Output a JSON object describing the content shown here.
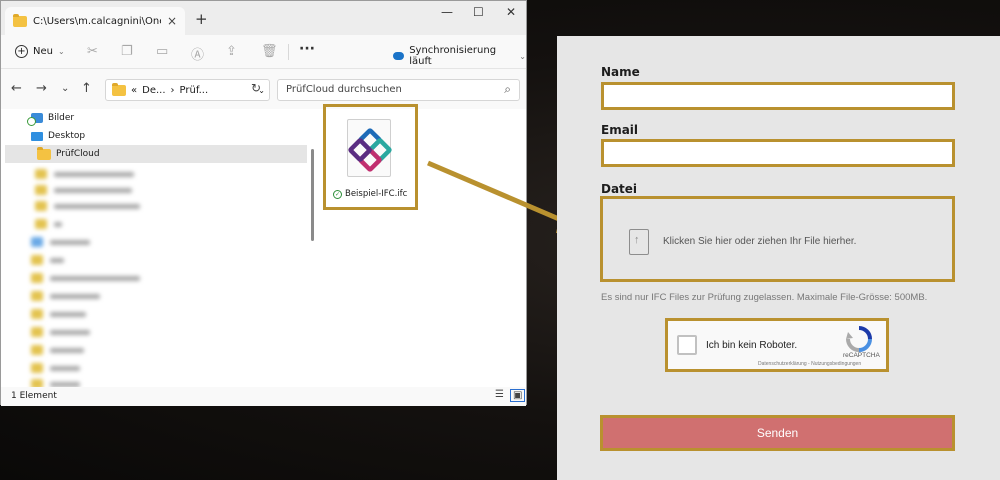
{
  "explorer": {
    "tab_title": "C:\\Users\\m.calcagnini\\OneDri",
    "tab_close": "×",
    "new_tab": "+",
    "window_controls": {
      "minimize": "—",
      "maximize": "☐",
      "close": "✕"
    },
    "toolbar": {
      "new_label": "Neu",
      "more": "···",
      "sync_label": "Synchronisierung läuft"
    },
    "address": {
      "crumb1": "De...",
      "crumb2": "Prüf...",
      "search_placeholder": "PrüfCloud durchsuchen"
    },
    "tree": [
      {
        "label": "Bilder"
      },
      {
        "label": "Desktop"
      },
      {
        "label": "PrüfCloud"
      }
    ],
    "file": {
      "name": "Beispiel-IFC.ifc"
    },
    "status": "1 Element"
  },
  "form": {
    "name_label": "Name",
    "email_label": "Email",
    "file_label": "Datei",
    "dropzone_text": "Klicken Sie hier oder ziehen Ihr File hierher.",
    "note": "Es sind nur IFC Files zur Prüfung zugelassen. Maximale File-Grösse: 500MB.",
    "captcha": {
      "label": "Ich bin kein Roboter.",
      "brand": "reCAPTCHA",
      "links": "Datenschutzerklärung - Nutzungsbedingungen"
    },
    "submit_label": "Senden"
  },
  "colors": {
    "highlight": "#b9912f",
    "submit": "#d07070",
    "form_bg": "#e6e6e6"
  }
}
